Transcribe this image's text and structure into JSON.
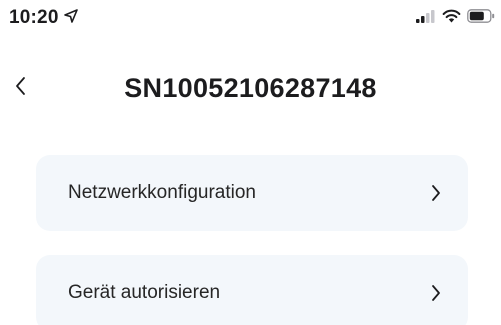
{
  "status_bar": {
    "time": "10:20",
    "location_icon": "location-arrow-icon",
    "signal_icon": "cellular-signal-icon",
    "wifi_icon": "wifi-icon",
    "battery_icon": "battery-icon"
  },
  "header": {
    "back_icon": "chevron-left-icon",
    "title": "SN10052106287148"
  },
  "menu": {
    "items": [
      {
        "label": "Netzwerkkonfiguration",
        "icon": "chevron-right-icon"
      },
      {
        "label": "Gerät autorisieren",
        "icon": "chevron-right-icon"
      }
    ]
  },
  "colors": {
    "card_background": "#f3f7fb",
    "text": "#1c1c1e"
  }
}
